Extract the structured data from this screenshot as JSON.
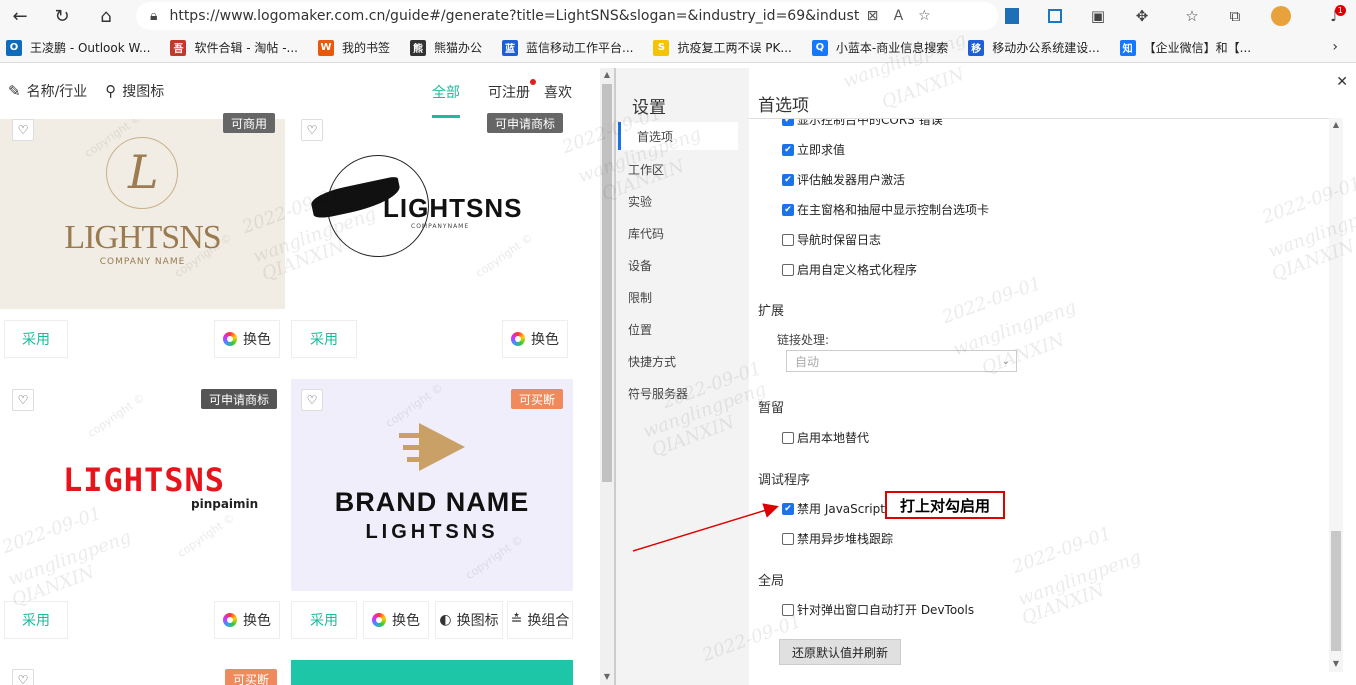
{
  "browser": {
    "url": "https://www.logomaker.com.cn/guide#/generate?title=LightSNS&slogan=&industry_id=69&industry_tag=&...",
    "bookmarks": [
      {
        "label": "王凌鹏 - Outlook W...",
        "color": "#0f6cbd",
        "icon": "O"
      },
      {
        "label": "软件合辑 - 淘帖 -...",
        "color": "#c0392b",
        "icon": "吾"
      },
      {
        "label": "我的书签",
        "color": "#e8590c",
        "icon": "W"
      },
      {
        "label": "熊猫办公",
        "color": "#333333",
        "icon": "熊"
      },
      {
        "label": "蓝信移动工作平台...",
        "color": "#1e5fd8",
        "icon": "蓝"
      },
      {
        "label": "抗疫复工两不误 PK...",
        "color": "#f5c400",
        "icon": "S"
      },
      {
        "label": "小蓝本-商业信息搜索",
        "color": "#1677ff",
        "icon": "Q"
      },
      {
        "label": "移动办公系统建设...",
        "color": "#1e5fd8",
        "icon": "移"
      },
      {
        "label": "【企业微信】和【...",
        "color": "#1677ff",
        "icon": "知"
      }
    ],
    "badge_count": "1"
  },
  "left": {
    "nav": {
      "name_industry": "名称/行业",
      "search_logo": "搜图标"
    },
    "tabs": [
      "全部",
      "可注册",
      "喜欢"
    ],
    "cards": [
      {
        "tag": "可商用",
        "use": "采用",
        "color": "换色",
        "brand": "LIGHTSNS",
        "sub": "COMPANY NAME"
      },
      {
        "tag": "可申请商标",
        "use": "采用",
        "color": "换色",
        "brand": "LIGHTSNS",
        "sub": "COMPANYNAME"
      },
      {
        "tag": "可申请商标",
        "use": "采用",
        "color": "换色",
        "brand": "LIGHTSNS",
        "sub": "pinpaimin"
      },
      {
        "tag": "可买断",
        "use": "采用",
        "color": "换色",
        "icon_swap": "换图标",
        "combo_swap": "换组合",
        "brand": "BRAND NAME",
        "sub": "LIGHTSNS"
      },
      {
        "tag": "可买断"
      }
    ],
    "copyright": "copyright ©"
  },
  "devtools": {
    "side_title": "设置",
    "side_items": [
      "首选项",
      "工作区",
      "实验",
      "库代码",
      "设备",
      "限制",
      "位置",
      "快捷方式",
      "符号服务器"
    ],
    "main_title": "首选项",
    "options_top": [
      {
        "label": "显示控制台中的CORS 错误",
        "checked": true
      },
      {
        "label": "立即求值",
        "checked": true
      },
      {
        "label": "评估触发器用户激活",
        "checked": true
      },
      {
        "label": "在主窗格和抽屉中显示控制台选项卡",
        "checked": true
      },
      {
        "label": "导航时保留日志",
        "checked": false
      },
      {
        "label": "启用自定义格式化程序",
        "checked": false
      }
    ],
    "ext_section": "扩展",
    "link_label": "链接处理:",
    "link_value": "自动",
    "persist_section": "暂留",
    "local_override": "启用本地替代",
    "debug_section": "调试程序",
    "disable_js": "禁用 JavaScript",
    "disable_async": "禁用异步堆栈跟踪",
    "global_section": "全局",
    "auto_open": "针对弹出窗口自动打开 DevTools",
    "reset_btn": "还原默认值并刷新"
  },
  "annotation": "打上对勾启用",
  "watermark": {
    "date": "2022-09-01",
    "name": "wanglingpeng",
    "org": "QIANXIN"
  }
}
